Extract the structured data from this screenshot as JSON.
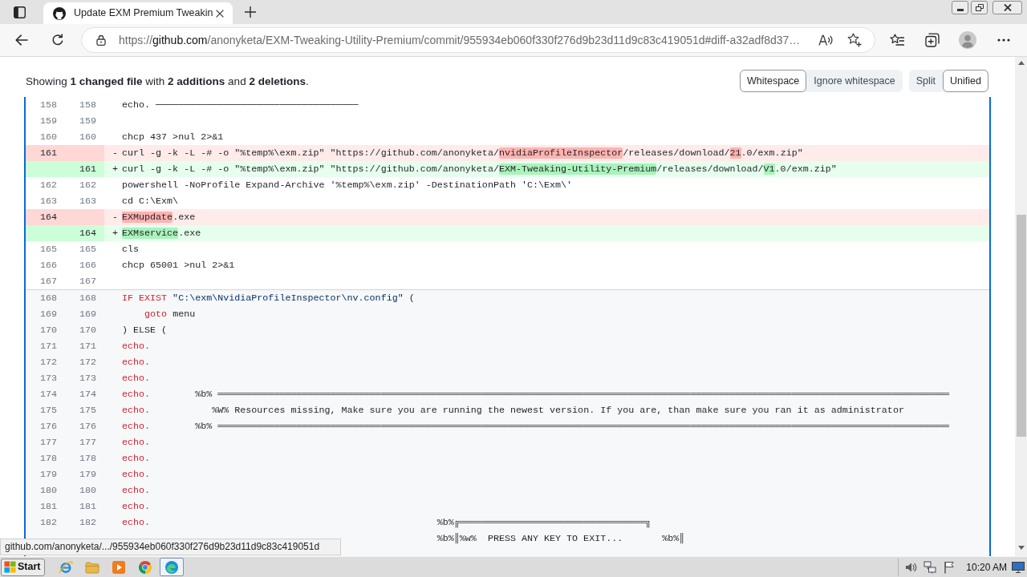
{
  "browser": {
    "tabs": [
      {
        "title": "Update EXM Premium Tweakin",
        "selected": true
      }
    ],
    "address": [
      {
        "text": "https://",
        "kind": "scheme"
      },
      {
        "text": "github.com",
        "kind": "host"
      },
      {
        "text": "/anonyketa/EXM-Tweaking-Utility-Premium/commit/955934eb060f330f276d9b23d11d9c83c419051d#diff-a32adf8d37…",
        "kind": "path"
      }
    ]
  },
  "diff_header": {
    "summary": "Showing **1 changed file** with **2 additions** and **2 deletions**.",
    "whitespace_options": [
      {
        "label": "Whitespace",
        "selected": true
      },
      {
        "label": "Ignore whitespace",
        "selected": false
      }
    ],
    "view_options": [
      {
        "label": "Split",
        "selected": false
      },
      {
        "label": "Unified",
        "selected": true
      }
    ]
  },
  "diff": {
    "blocks": [
      {
        "shaded": false,
        "lines": [
          {
            "kind": "context",
            "old": "158",
            "new": "158",
            "tokens": [
              {
                "text": "echo. ────────────────────────────────────",
                "kind": "plain"
              }
            ]
          },
          {
            "kind": "context",
            "old": "159",
            "new": "159"
          },
          {
            "kind": "context",
            "old": "160",
            "new": "160",
            "tokens": [
              {
                "text": "chcp 437 >nul 2>&1",
                "kind": "plain"
              }
            ]
          },
          {
            "kind": "deletion",
            "old": "161",
            "sign": "-",
            "tokens": [
              {
                "text": "curl -g -k -L -# -o \"%temp%\\exm.zip\" \"https://github.com/anonyketa/",
                "kind": "plain"
              },
              {
                "text": "nvidiaProfileInspector",
                "kind": "changed"
              },
              {
                "text": "/releases/download/",
                "kind": "plain"
              },
              {
                "text": "21",
                "kind": "changed"
              },
              {
                "text": ".0/exm.zip\"",
                "kind": "plain"
              }
            ]
          },
          {
            "kind": "addition",
            "new": "161",
            "sign": "+",
            "tokens": [
              {
                "text": "curl -g -k -L -# -o \"%temp%\\exm.zip\" \"https://github.com/anonyketa/",
                "kind": "plain"
              },
              {
                "text": "EXM-Tweaking-Utility-Premium",
                "kind": "changed"
              },
              {
                "text": "/releases/download/",
                "kind": "plain"
              },
              {
                "text": "V1",
                "kind": "changed"
              },
              {
                "text": ".0/exm.zip\"",
                "kind": "plain"
              }
            ]
          },
          {
            "kind": "context",
            "old": "162",
            "new": "162",
            "tokens": [
              {
                "text": "powershell -NoProfile Expand-Archive '%temp%\\exm.zip' -DestinationPath 'C:\\Exm\\'",
                "kind": "plain"
              }
            ]
          },
          {
            "kind": "context",
            "old": "163",
            "new": "163",
            "tokens": [
              {
                "text": "cd C:\\Exm\\",
                "kind": "plain"
              }
            ]
          },
          {
            "kind": "deletion",
            "old": "164",
            "sign": "-",
            "tokens": [
              {
                "text": "EXMupdate",
                "kind": "changed"
              },
              {
                "text": ".exe",
                "kind": "plain"
              }
            ]
          },
          {
            "kind": "addition",
            "new": "164",
            "sign": "+",
            "tokens": [
              {
                "text": "EXMservice",
                "kind": "changed"
              },
              {
                "text": ".exe",
                "kind": "plain"
              }
            ]
          },
          {
            "kind": "context",
            "old": "165",
            "new": "165",
            "tokens": [
              {
                "text": "cls",
                "kind": "plain"
              }
            ]
          },
          {
            "kind": "context",
            "old": "166",
            "new": "166",
            "tokens": [
              {
                "text": "chcp 65001 >nul 2>&1",
                "kind": "plain"
              }
            ]
          },
          {
            "kind": "context",
            "old": "167",
            "new": "167"
          }
        ]
      },
      {
        "shaded": true,
        "lines": [
          {
            "kind": "context",
            "old": "168",
            "new": "168",
            "tokens": [
              {
                "text": "IF EXIST",
                "kind": "keyword"
              },
              {
                "text": " \"C:\\exm\\NvidiaProfileInspector\\nv.config\"",
                "kind": "string"
              },
              {
                "text": " (",
                "kind": "plain"
              }
            ]
          },
          {
            "kind": "context",
            "old": "169",
            "new": "169",
            "tokens": [
              {
                "text": "    goto",
                "kind": "keyword"
              },
              {
                "text": " menu",
                "kind": "plain"
              }
            ]
          },
          {
            "kind": "context",
            "old": "170",
            "new": "170",
            "tokens": [
              {
                "text": ") ELSE (",
                "kind": "plain"
              }
            ]
          },
          {
            "kind": "context",
            "old": "171",
            "new": "171",
            "tokens": [
              {
                "text": "echo.",
                "kind": "keyword"
              }
            ]
          },
          {
            "kind": "context",
            "old": "172",
            "new": "172",
            "tokens": [
              {
                "text": "echo.",
                "kind": "keyword"
              }
            ]
          },
          {
            "kind": "context",
            "old": "173",
            "new": "173",
            "tokens": [
              {
                "text": "echo.",
                "kind": "keyword"
              }
            ]
          },
          {
            "kind": "context",
            "old": "174",
            "new": "174",
            "tokens": [
              {
                "text": "echo.",
                "kind": "keyword"
              },
              {
                "text": "        %b% ══════════════════════════════════════════════════════════════════════════════════════════════════════════════════════════════════",
                "kind": "plain"
              }
            ]
          },
          {
            "kind": "context",
            "old": "175",
            "new": "175",
            "tokens": [
              {
                "text": "echo.",
                "kind": "keyword"
              },
              {
                "text": "           %W% Resources missing, Make sure you are running the newest version. If you are, than make sure you ran it as administrator",
                "kind": "plain"
              }
            ]
          },
          {
            "kind": "context",
            "old": "176",
            "new": "176",
            "tokens": [
              {
                "text": "echo.",
                "kind": "keyword"
              },
              {
                "text": "        %b% ══════════════════════════════════════════════════════════════════════════════════════════════════════════════════════════════════",
                "kind": "plain"
              }
            ]
          },
          {
            "kind": "context",
            "old": "177",
            "new": "177",
            "tokens": [
              {
                "text": "echo.",
                "kind": "keyword"
              }
            ]
          },
          {
            "kind": "context",
            "old": "178",
            "new": "178",
            "tokens": [
              {
                "text": "echo.",
                "kind": "keyword"
              }
            ]
          },
          {
            "kind": "context",
            "old": "179",
            "new": "179",
            "tokens": [
              {
                "text": "echo.",
                "kind": "keyword"
              }
            ]
          },
          {
            "kind": "context",
            "old": "180",
            "new": "180",
            "tokens": [
              {
                "text": "echo.",
                "kind": "keyword"
              }
            ]
          },
          {
            "kind": "context",
            "old": "181",
            "new": "181",
            "tokens": [
              {
                "text": "echo.",
                "kind": "keyword"
              }
            ]
          },
          {
            "kind": "context",
            "old": "182",
            "new": "182",
            "tokens": [
              {
                "text": "echo.",
                "kind": "keyword"
              },
              {
                "text": "                                                   %b%╔═════════════════════════════════╗",
                "kind": "plain"
              }
            ]
          },
          {
            "kind": "context",
            "tokens": [
              {
                "text": "                                                        %b%║%w%  PRESS ANY KEY TO EXIT...       %b%║",
                "kind": "plain"
              }
            ]
          }
        ]
      }
    ]
  },
  "status_link": "github.com/anonyketa/.../955934eb060f330f276d9b23d11d9c83c419051d",
  "taskbar": {
    "start": "Start",
    "apps": [
      {
        "kind": "ie",
        "selected": false
      },
      {
        "kind": "explorer",
        "selected": false
      },
      {
        "kind": "media",
        "selected": false
      },
      {
        "kind": "chrome",
        "selected": false
      },
      {
        "kind": "edge",
        "selected": true
      }
    ],
    "clock": "10:20 AM"
  }
}
